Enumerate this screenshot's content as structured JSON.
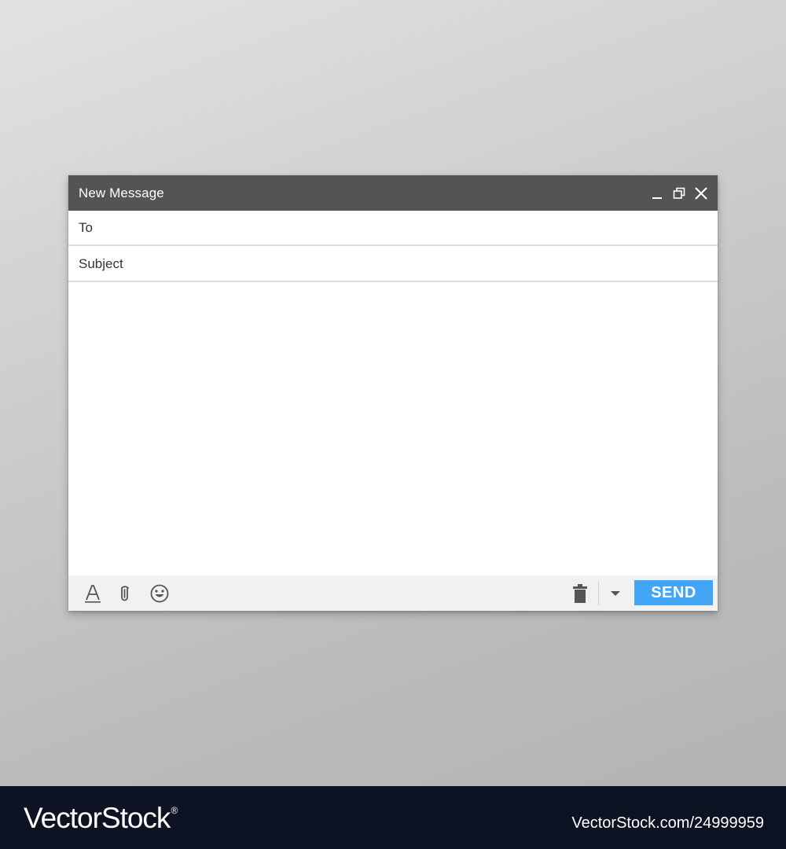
{
  "window": {
    "title": "New Message"
  },
  "compose": {
    "to_label": "To",
    "to_value": "",
    "subject_label": "Subject",
    "subject_value": "",
    "body_value": ""
  },
  "toolbar": {
    "send_label": "SEND",
    "send_color": "#42a5f5",
    "icons": [
      "text-format-icon",
      "attachment-icon",
      "emoji-icon",
      "trash-icon",
      "more-options-dropdown-icon"
    ]
  },
  "titlebar_controls": [
    "minimize-icon",
    "popout-icon",
    "close-icon"
  ],
  "footer": {
    "brand": "VectorStock",
    "registered_mark": "®",
    "id_text": "VectorStock.com/24999959"
  },
  "colors": {
    "titlebar": "#545454",
    "toolbar": "#f1f1f1",
    "footer": "#0e1323"
  }
}
